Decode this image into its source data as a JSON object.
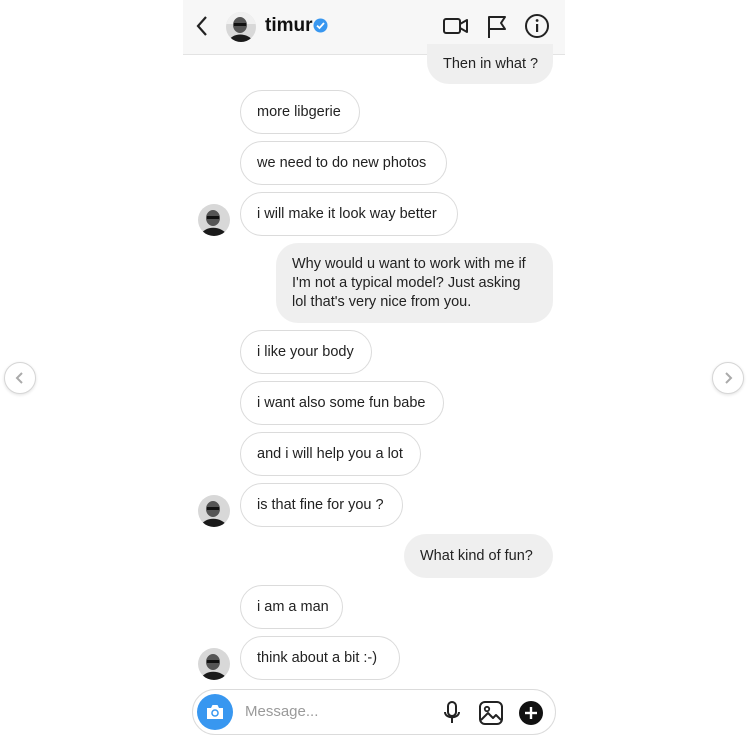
{
  "header": {
    "title": "timur",
    "icons": [
      "back-chevron-icon",
      "verified-badge-icon",
      "video-call-icon",
      "flag-icon",
      "info-icon"
    ]
  },
  "messages": [
    {
      "side": "out",
      "text": "Then in what ?"
    },
    {
      "side": "in",
      "text": "more libgerie"
    },
    {
      "side": "in",
      "text": "we need to do new photos"
    },
    {
      "side": "in",
      "text": "i will make it look way better"
    },
    {
      "side": "out",
      "text": "Why would u want to work with me if I'm not a typical model? Just asking lol that's very nice from you."
    },
    {
      "side": "in",
      "text": "i like your body"
    },
    {
      "side": "in",
      "text": "i want also some fun babe"
    },
    {
      "side": "in",
      "text": "and i will help you a lot"
    },
    {
      "side": "in",
      "text": "is that fine for you ?"
    },
    {
      "side": "out",
      "text": "What kind of fun?"
    },
    {
      "side": "in",
      "text": "i am a man"
    },
    {
      "side": "in",
      "text": "think about a bit :-)"
    }
  ],
  "composer": {
    "placeholder": "Message...",
    "icons": [
      "camera-icon",
      "microphone-icon",
      "gallery-icon",
      "plus-icon"
    ]
  },
  "carousel": {
    "icons": [
      "previous-arrow-icon",
      "next-arrow-icon"
    ]
  },
  "colors": {
    "accent": "#3897f0",
    "verified": "#3897f0",
    "outgoing_bubble": "#efefef",
    "incoming_border": "#dbdbdb"
  }
}
